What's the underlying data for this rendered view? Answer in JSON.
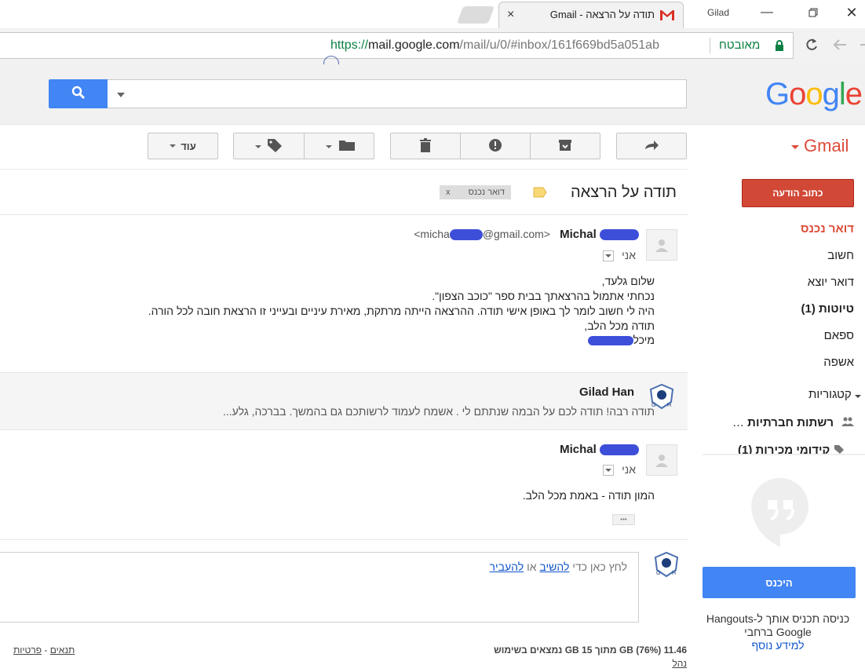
{
  "browser": {
    "tab_title": "תודה על הרצאה - Gmail",
    "tab_close": "×",
    "profile_name": "Gilad",
    "secure_label": "מאובטח",
    "url_scheme": "https://",
    "url_host": "mail.google.com",
    "url_path": "/mail/u/0/#inbox/161f669bd5a051ab"
  },
  "header": {
    "logo": "Google",
    "logo_colors": [
      "#4285f4",
      "#ea4335",
      "#fbbc05",
      "#4285f4",
      "#34a853",
      "#ea4335"
    ]
  },
  "sidebar": {
    "product": "Gmail",
    "compose": "כתוב הודעה",
    "items": [
      {
        "label": "דואר נכנס"
      },
      {
        "label": "חשוב"
      },
      {
        "label": "דואר יוצא"
      },
      {
        "label": "טיוטות (1)"
      },
      {
        "label": "ספאם"
      },
      {
        "label": "אשפה"
      },
      {
        "label": "קטגוריות"
      },
      {
        "label": "רשתות חברתיות"
      },
      {
        "label": "קידומי מכירות (1)"
      }
    ],
    "more_dots": "…",
    "hangouts_signin": "היכנס",
    "hangouts_text_1": "כניסה תכניס אותך ל-Hangouts",
    "hangouts_text_2": "ברחבי Google",
    "hangouts_learn_more": "למידע נוסף"
  },
  "toolbar": {
    "more": "עוד"
  },
  "thread": {
    "subject": "תודה על הרצאה",
    "label": "דואר נכנס",
    "label_remove": "x",
    "messages": [
      {
        "sender": "Michal",
        "email_prefix": "<micha",
        "email_suffix": "@gmail.com>",
        "to": "אני",
        "lines": [
          "שלום גלעד,",
          "נכחתי אתמול בהרצאתך בבית ספר \"כוכב הצפון\".",
          "היה לי חשוב לומר לך באופן אישי תודה. ההרצאה הייתה מרתקת, מאירת עיניים ובעייני זו הרצאת חובה לכל הורה.",
          "תודה מכל הלב,",
          "מיכל"
        ]
      },
      {
        "sender": "Gilad Han",
        "snippet": "תודה רבה! תודה לכם על הבמה שנתתם לי . אשמח לעמוד לרשותכם גם בהמשך. בברכה, גלע..."
      },
      {
        "sender": "Michal",
        "to": "אני",
        "lines": [
          "המון תודה - באמת מכל הלב."
        ],
        "ellipsis": "•••"
      }
    ],
    "reply_prefix": "לחץ כאן כדי ",
    "reply_link": "להשיב",
    "reply_or": " או ",
    "forward_link": "להעביר"
  },
  "footer": {
    "storage": "11.46 GB (76%) מתוך 15 GB נמצאים בשימוש",
    "manage": "נהל",
    "terms": "תנאים",
    "sep": " - ",
    "privacy": "פרטיות"
  }
}
